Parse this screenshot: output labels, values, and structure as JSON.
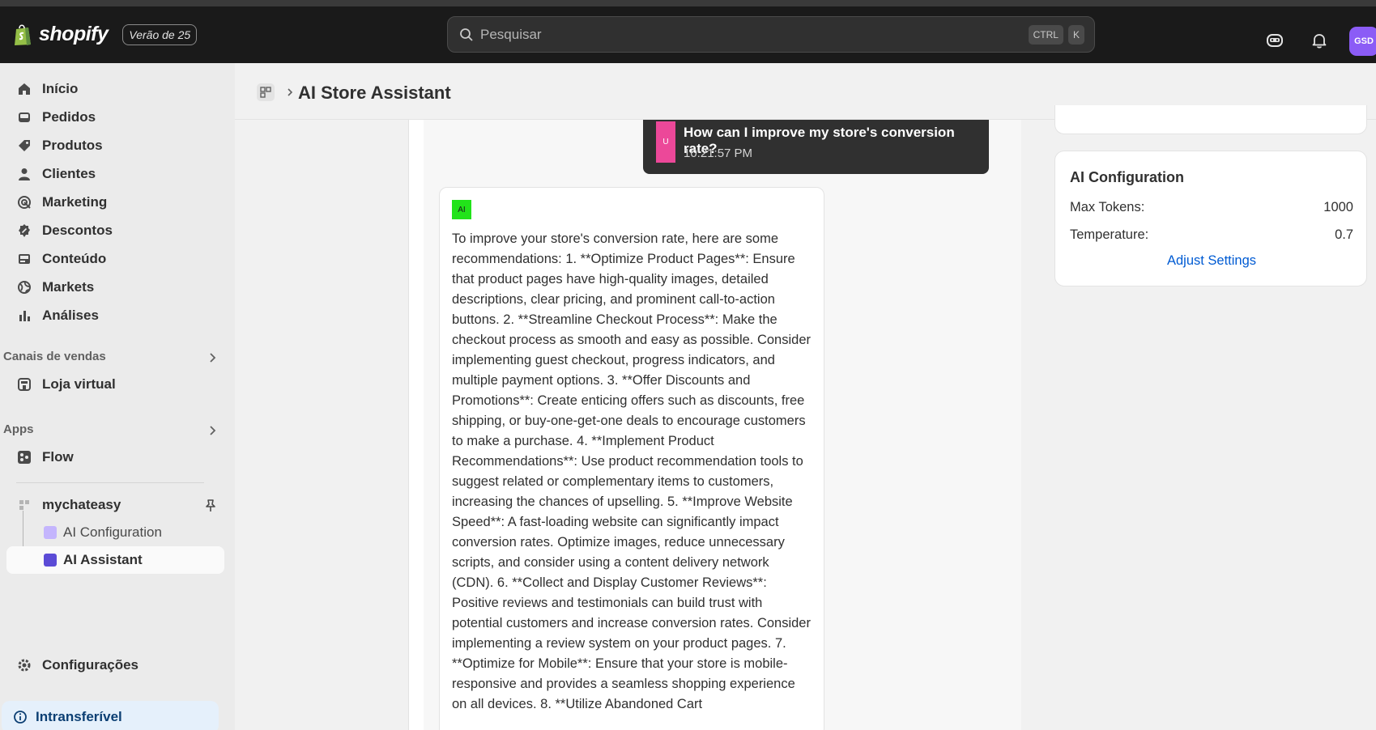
{
  "topbar": {
    "brand": "shopify",
    "version_badge": "Verão de 25",
    "search_placeholder": "Pesquisar",
    "shortcut_keys": [
      "CTRL",
      "K"
    ],
    "avatar_initials": "GSD"
  },
  "sidebar": {
    "nav": [
      {
        "label": "Início",
        "icon": "home-icon"
      },
      {
        "label": "Pedidos",
        "icon": "inbox-icon"
      },
      {
        "label": "Produtos",
        "icon": "tag-icon"
      },
      {
        "label": "Clientes",
        "icon": "person-icon"
      },
      {
        "label": "Marketing",
        "icon": "target-icon"
      },
      {
        "label": "Descontos",
        "icon": "discount-icon"
      },
      {
        "label": "Conteúdo",
        "icon": "image-icon"
      },
      {
        "label": "Markets",
        "icon": "globe-icon"
      },
      {
        "label": "Análises",
        "icon": "chart-icon"
      }
    ],
    "sales_channels_title": "Canais de vendas",
    "sales_channels": [
      {
        "label": "Loja virtual",
        "icon": "store-icon"
      }
    ],
    "apps_title": "Apps",
    "apps": [
      {
        "label": "Flow",
        "icon": "flow-icon"
      }
    ],
    "app_group": {
      "label": "mychateasy",
      "children": [
        {
          "label": "AI Configuration"
        },
        {
          "label": "AI Assistant"
        }
      ]
    },
    "settings_label": "Configurações",
    "plan_label": "Intransferível"
  },
  "page": {
    "title": "AI Store Assistant"
  },
  "chat": {
    "user_message": {
      "avatar": "U",
      "text": "How can I improve my store's conversion rate?",
      "time": "10:21:57 PM"
    },
    "ai_message": {
      "avatar": "AI",
      "text": "To improve your store's conversion rate, here are some recommendations: 1. **Optimize Product Pages**: Ensure that product pages have high-quality images, detailed descriptions, clear pricing, and prominent call-to-action buttons. 2. **Streamline Checkout Process**: Make the checkout process as smooth and easy as possible. Consider implementing guest checkout, progress indicators, and multiple payment options. 3. **Offer Discounts and Promotions**: Create enticing offers such as discounts, free shipping, or buy-one-get-one deals to encourage customers to make a purchase. 4. **Implement Product Recommendations**: Use product recommendation tools to suggest related or complementary items to customers, increasing the chances of upselling. 5. **Improve Website Speed**: A fast-loading website can significantly impact conversion rates. Optimize images, reduce unnecessary scripts, and consider using a content delivery network (CDN). 6. **Collect and Display Customer Reviews**: Positive reviews and testimonials can build trust with potential customers and increase conversion rates. Consider implementing a review system on your product pages. 7. **Optimize for Mobile**: Ensure that your store is mobile-responsive and provides a seamless shopping experience on all devices. 8. **Utilize Abandoned Cart"
    }
  },
  "config_card": {
    "title": "AI Configuration",
    "rows": [
      {
        "label": "Max Tokens:",
        "value": "1000"
      },
      {
        "label": "Temperature:",
        "value": "0.7"
      }
    ],
    "link": "Adjust Settings"
  },
  "colors": {
    "topbar_bg": "#1a1a1a",
    "user_avatar": "#ec4899",
    "ai_avatar": "#22e31a",
    "link": "#005bd3",
    "avatar_bg": "#8b5cf6"
  }
}
